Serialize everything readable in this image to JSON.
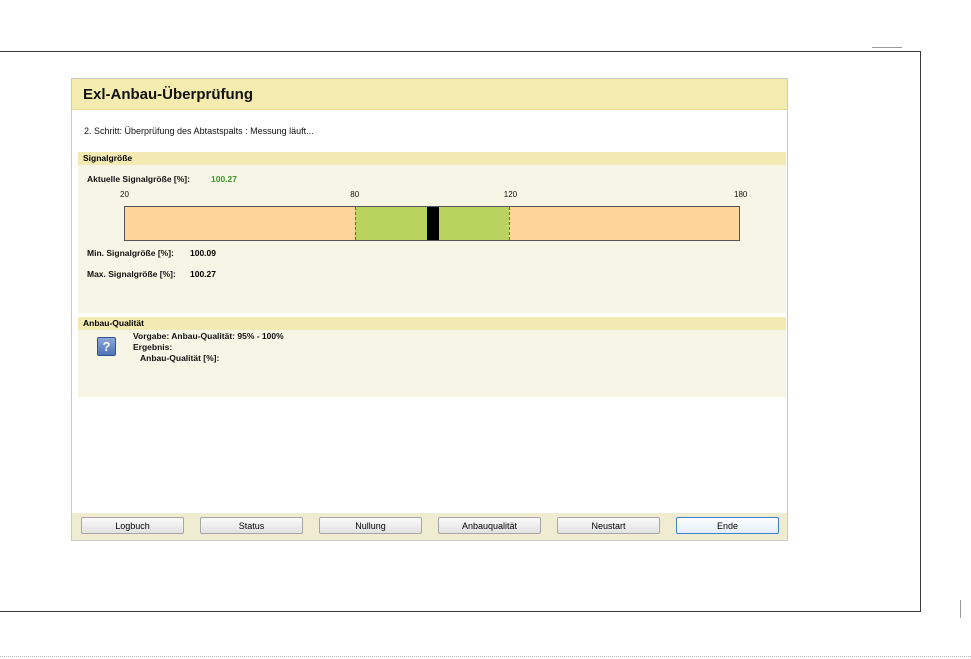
{
  "window": {
    "title": "Exl-Anbau-Überprüfung",
    "step_text": "2. Schritt: Überprüfung des Abtastspalts : Messung läuft..."
  },
  "signal_section": {
    "header": "Signalgröße",
    "current_label": "Aktuelle Signalgröße [%]:",
    "current_value": "100.27",
    "min_label": "Min. Signalgröße [%]:",
    "min_value": "100.09",
    "max_label": "Max. Signalgröße [%]:",
    "max_value": "100.27"
  },
  "scale": {
    "min": 20,
    "max": 180,
    "green_from": 80,
    "green_to": 120,
    "indicator_value": 100.27,
    "ticks": [
      "20",
      "80",
      "120",
      "180"
    ]
  },
  "quality_section": {
    "header": "Anbau-Qualität",
    "spec": "Vorgabe: Anbau-Qualität: 95% - 100%",
    "result_label": "Ergebnis:",
    "quality_label": "Anbau-Qualität [%]:",
    "icon": "question-icon"
  },
  "buttons": {
    "log": "Logbuch",
    "status": "Status",
    "zero": "Nullung",
    "quality": "Anbauqualität",
    "restart": "Neustart",
    "end": "Ende"
  },
  "colors": {
    "title_bg": "#f4ecae",
    "section_header_bg": "#f2e9b3",
    "section_body_bg": "#f7f5e5",
    "scale_out_of_range": "#fdd59a",
    "scale_in_range": "#b8d45e",
    "current_value_text": "#3a9a2a"
  }
}
